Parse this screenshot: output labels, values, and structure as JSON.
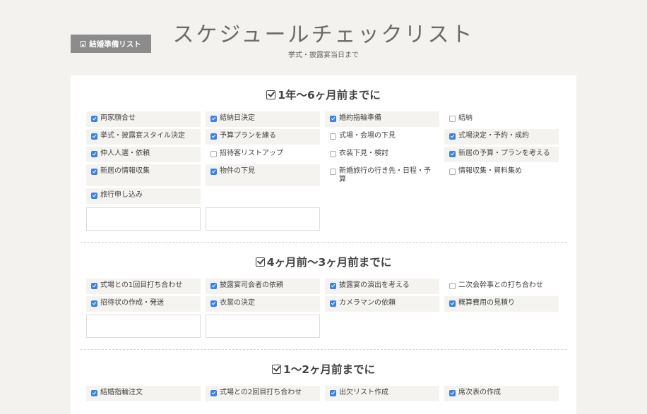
{
  "header": {
    "list_button": "結婚準備リスト",
    "title": "スケジュールチェックリスト",
    "subtitle": "挙式・披露宴当日まで"
  },
  "sections": [
    {
      "title": "1年〜6ヶ月前までに",
      "items": [
        {
          "label": "両家顔合せ",
          "checked": true
        },
        {
          "label": "結納日決定",
          "checked": true
        },
        {
          "label": "婚約指輪準備",
          "checked": true
        },
        {
          "label": "結納",
          "checked": false
        },
        {
          "label": "挙式・披露宴スタイル決定",
          "checked": true
        },
        {
          "label": "予算プランを練る",
          "checked": true
        },
        {
          "label": "式場・会場の下見",
          "checked": false
        },
        {
          "label": "式場決定・予約・成約",
          "checked": true
        },
        {
          "label": "仲人人選・依頼",
          "checked": true
        },
        {
          "label": "招待客リストアップ",
          "checked": false
        },
        {
          "label": "衣装下見・検討",
          "checked": false
        },
        {
          "label": "新居の予算・プランを考える",
          "checked": true
        },
        {
          "label": "新居の情報収集",
          "checked": true
        },
        {
          "label": "物件の下見",
          "checked": true
        },
        {
          "label": "新婚旅行の行き先・日程・予算",
          "checked": false
        },
        {
          "label": "情報収集・資料集め",
          "checked": false
        },
        {
          "label": "旅行申し込み",
          "checked": true
        }
      ]
    },
    {
      "title": "4ヶ月前〜3ヶ月前までに",
      "items": [
        {
          "label": "式場との1回目打ち合わせ",
          "checked": true
        },
        {
          "label": "披露宴司会者の依頼",
          "checked": true
        },
        {
          "label": "披露宴の演出を考える",
          "checked": true
        },
        {
          "label": "二次会幹事との打ち合わせ",
          "checked": false
        },
        {
          "label": "招待状の作成・発送",
          "checked": true
        },
        {
          "label": "衣裳の決定",
          "checked": true
        },
        {
          "label": "カメラマンの依頼",
          "checked": true
        },
        {
          "label": "概算費用の見積り",
          "checked": true
        }
      ]
    },
    {
      "title": "1〜2ヶ月前までに",
      "items": [
        {
          "label": "結婚指輪注文",
          "checked": true
        },
        {
          "label": "式場との2回目打ち合わせ",
          "checked": true
        },
        {
          "label": "出欠リスト作成",
          "checked": true
        },
        {
          "label": "席次表の作成",
          "checked": true
        }
      ]
    }
  ]
}
